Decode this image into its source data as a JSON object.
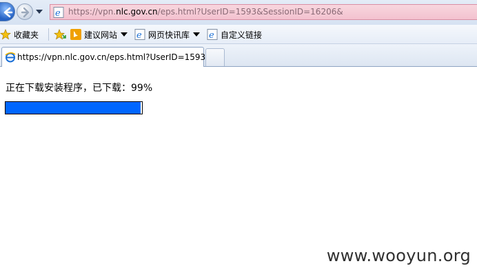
{
  "address_bar": {
    "url_prefix": "https://vpn.",
    "url_domain": "nlc.gov.cn",
    "url_rest": "/eps.html?UserID=1593&SessionID=16206&"
  },
  "favorites_bar": {
    "favorites_label": "收藏夹",
    "items": [
      {
        "label": "建议网站",
        "icon": "bing-icon",
        "has_dropdown": true
      },
      {
        "label": "网页快讯库",
        "icon": "ie-icon",
        "has_dropdown": true
      },
      {
        "label": "自定义链接",
        "icon": "ie-page-icon",
        "has_dropdown": false
      }
    ]
  },
  "tabs": [
    {
      "title": "https://vpn.nlc.gov.cn/eps.html?UserID=1593...",
      "active": true
    }
  ],
  "page": {
    "status_text": "正在下载安装程序，已下载：99%",
    "progress_fraction": 0.99,
    "progress_color": "#0066ff"
  },
  "watermark": "www.wooyun.org",
  "colors": {
    "address_bar_bg": "#f3c2cf",
    "chrome_bg": "#dde6f2"
  }
}
